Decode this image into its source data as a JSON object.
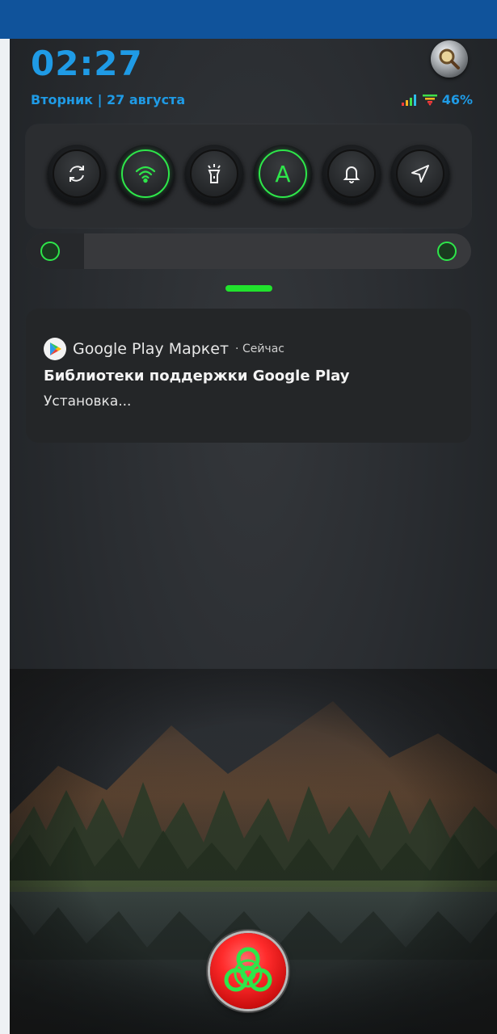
{
  "status": {
    "time": "02:27",
    "date": "Вторник | 27 августа",
    "battery": "46%"
  },
  "quick_settings": {
    "toggles": [
      {
        "name": "auto-rotate",
        "icon": "sync-icon",
        "state": "off"
      },
      {
        "name": "wifi",
        "icon": "wifi-icon",
        "state": "on"
      },
      {
        "name": "flashlight",
        "icon": "flashlight-icon",
        "state": "off"
      },
      {
        "name": "auto-brightness",
        "icon": "letter-a-icon",
        "label": "A",
        "state": "on"
      },
      {
        "name": "sound",
        "icon": "bell-icon",
        "state": "off"
      },
      {
        "name": "location",
        "icon": "navigation-arrow-icon",
        "state": "off"
      }
    ],
    "accent_color": "#2ee64a"
  },
  "notification": {
    "app_name": "Google Play Маркет",
    "time": "· Сейчас",
    "title": "Библиотеки поддержки Google Play",
    "text": "Установка..."
  },
  "colors": {
    "accent_blue": "#1f9be6",
    "top_bar": "#10539b",
    "panel": "#2b2d30",
    "button_red": "#ff2b2b"
  }
}
